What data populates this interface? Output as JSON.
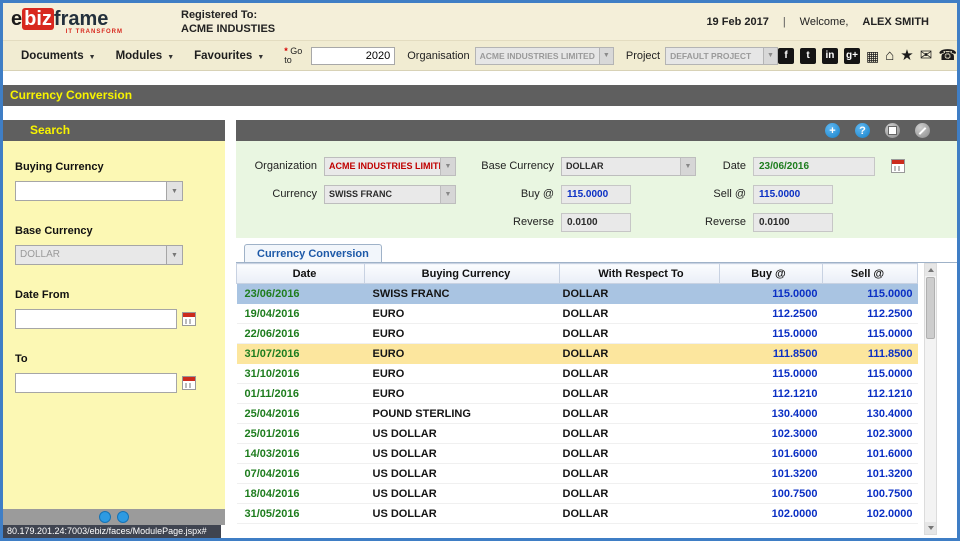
{
  "header": {
    "logo_e": "e",
    "logo_biz": "biz",
    "logo_frame": "frame",
    "logo_tagline": "IT TRANSFORM",
    "registered_label": "Registered To:",
    "registered_value": "ACME INDUSTIES",
    "date": "19 Feb 2017",
    "separator": "|",
    "welcome_label": "Welcome,",
    "user_name": "ALEX SMITH"
  },
  "menubar": {
    "items": [
      {
        "label": "Documents"
      },
      {
        "label": "Modules"
      },
      {
        "label": "Favourites"
      }
    ],
    "goto_star": "*",
    "goto_label": "Go to",
    "goto_value": "2020",
    "organisation_label": "Organisation",
    "organisation_value": "ACME INDUSTRIES LIMITED",
    "project_label": "Project",
    "project_value": "DEFAULT PROJECT"
  },
  "icons": {
    "facebook": "f",
    "twitter": "t",
    "linkedin": "in",
    "googleplus": "g+",
    "apps": "▦",
    "home": "⌂",
    "star": "★",
    "mail": "✉",
    "phone": "☎",
    "plus": "+",
    "help": "?"
  },
  "page_title": "Currency Conversion",
  "sidebar": {
    "search_title": "Search",
    "buying_currency_label": "Buying Currency",
    "base_currency_label": "Base Currency",
    "base_currency_value": "DOLLAR",
    "date_from_label": "Date From",
    "to_label": "To",
    "status_url": "80.179.201.24:7003/ebiz/faces/ModulePage.jspx#"
  },
  "form": {
    "organization_label": "Organization",
    "organization_value": "ACME INDUSTRIES LIMITED",
    "base_currency_label": "Base Currency",
    "base_currency_value": "DOLLAR",
    "date_label": "Date",
    "date_value": "23/06/2016",
    "currency_label": "Currency",
    "currency_value": "SWISS FRANC",
    "buy_label": "Buy @",
    "buy_value": "115.0000",
    "sell_label": "Sell @",
    "sell_value": "115.0000",
    "reverse_label_1": "Reverse",
    "reverse_value_1": "0.0100",
    "reverse_label_2": "Reverse",
    "reverse_value_2": "0.0100"
  },
  "tabs": {
    "currency_conversion": "Currency Conversion"
  },
  "table": {
    "headers": [
      "Date",
      "Buying Currency",
      "With Respect To",
      "Buy @",
      "Sell @"
    ],
    "rows": [
      {
        "date": "23/06/2016",
        "currency": "SWISS FRANC",
        "wrt": "DOLLAR",
        "buy": "115.0000",
        "sell": "115.0000",
        "highlight": "blue"
      },
      {
        "date": "19/04/2016",
        "currency": "EURO",
        "wrt": "DOLLAR",
        "buy": "112.2500",
        "sell": "112.2500",
        "highlight": ""
      },
      {
        "date": "22/06/2016",
        "currency": "EURO",
        "wrt": "DOLLAR",
        "buy": "115.0000",
        "sell": "115.0000",
        "highlight": ""
      },
      {
        "date": "31/07/2016",
        "currency": "EURO",
        "wrt": "DOLLAR",
        "buy": "111.8500",
        "sell": "111.8500",
        "highlight": "yellow"
      },
      {
        "date": "31/10/2016",
        "currency": "EURO",
        "wrt": "DOLLAR",
        "buy": "115.0000",
        "sell": "115.0000",
        "highlight": ""
      },
      {
        "date": "01/11/2016",
        "currency": "EURO",
        "wrt": "DOLLAR",
        "buy": "112.1210",
        "sell": "112.1210",
        "highlight": ""
      },
      {
        "date": "25/04/2016",
        "currency": "POUND STERLING",
        "wrt": "DOLLAR",
        "buy": "130.4000",
        "sell": "130.4000",
        "highlight": ""
      },
      {
        "date": "25/01/2016",
        "currency": "US DOLLAR",
        "wrt": "DOLLAR",
        "buy": "102.3000",
        "sell": "102.3000",
        "highlight": ""
      },
      {
        "date": "14/03/2016",
        "currency": "US DOLLAR",
        "wrt": "DOLLAR",
        "buy": "101.6000",
        "sell": "101.6000",
        "highlight": ""
      },
      {
        "date": "07/04/2016",
        "currency": "US DOLLAR",
        "wrt": "DOLLAR",
        "buy": "101.3200",
        "sell": "101.3200",
        "highlight": ""
      },
      {
        "date": "18/04/2016",
        "currency": "US DOLLAR",
        "wrt": "DOLLAR",
        "buy": "100.7500",
        "sell": "100.7500",
        "highlight": ""
      },
      {
        "date": "31/05/2016",
        "currency": "US DOLLAR",
        "wrt": "DOLLAR",
        "buy": "102.0000",
        "sell": "102.0000",
        "highlight": ""
      }
    ]
  },
  "colors": {
    "border_blue": "#3f7ec5",
    "title_yellow": "#f8f400",
    "bar_gray": "#5f5f5f",
    "sidebar_yellow": "#fcf8b4",
    "form_green": "#e9f6e1",
    "row_highlight_blue": "#a9c4e2",
    "row_highlight_yellow": "#fce69e",
    "date_green": "#1e7d1e",
    "value_blue": "#0a2fc4",
    "org_red": "#c00000"
  }
}
